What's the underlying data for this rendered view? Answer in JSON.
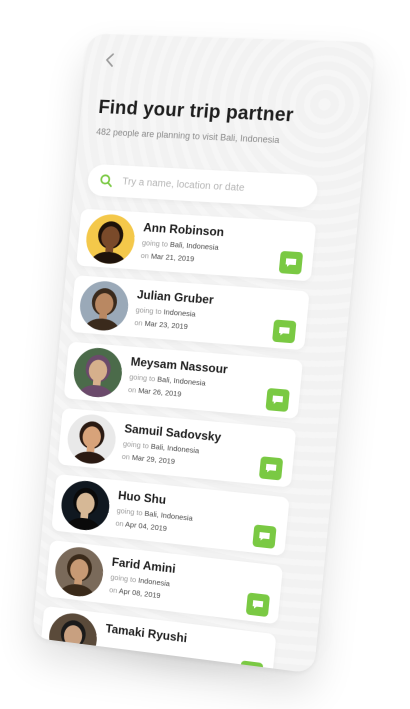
{
  "header": {
    "back_icon": "chevron-left-icon",
    "title": "Find your trip partner",
    "subtitle": "482 people are planning to visit Bali, Indonesia"
  },
  "search": {
    "placeholder": "Try a name, location or date",
    "icon": "search-icon"
  },
  "colors": {
    "accent": "#7ac943",
    "background": "#f2f2f2",
    "card": "#ffffff"
  },
  "labels": {
    "going_prefix": "going to",
    "date_prefix": "on"
  },
  "partners": [
    {
      "name": "Ann Robinson",
      "destination": "Bali, Indonesia",
      "date": "Mar 21, 2019",
      "avatar_bg": "#f4c84a",
      "skin": "#7a4a2a",
      "hair": "#1e120a"
    },
    {
      "name": "Julian Gruber",
      "destination": "Indonesia",
      "date": "Mar 23, 2019",
      "avatar_bg": "#9aa9b8",
      "skin": "#b98862",
      "hair": "#3a2a1c"
    },
    {
      "name": "Meysam Nassour",
      "destination": "Bali, Indonesia",
      "date": "Mar 26, 2019",
      "avatar_bg": "#4b6b4a",
      "skin": "#d6b08c",
      "hair": "#6b4a6b"
    },
    {
      "name": "Samuil Sadovsky",
      "destination": "Bali, Indonesia",
      "date": "Mar 29, 2019",
      "avatar_bg": "#e9e9e9",
      "skin": "#d8a37a",
      "hair": "#2a1a12"
    },
    {
      "name": "Huo Shu",
      "destination": "Bali, Indonesia",
      "date": "Apr 04, 2019",
      "avatar_bg": "#101820",
      "skin": "#d6b896",
      "hair": "#0a0a0a"
    },
    {
      "name": "Farid Amini",
      "destination": "Indonesia",
      "date": "Apr 08, 2019",
      "avatar_bg": "#7a6a5a",
      "skin": "#c89a74",
      "hair": "#3a2a1a"
    },
    {
      "name": "Tamaki Ryushi",
      "destination": "",
      "date": "",
      "avatar_bg": "#5a4a3a",
      "skin": "#c8a080",
      "hair": "#1a1a1a"
    }
  ]
}
